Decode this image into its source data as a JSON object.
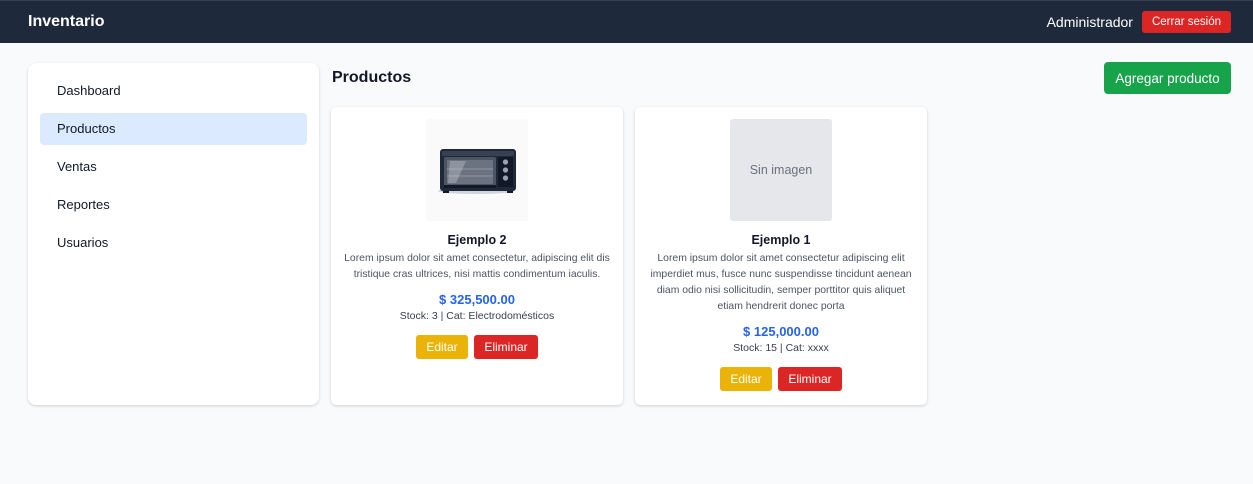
{
  "header": {
    "brand": "Inventario",
    "user": "Administrador",
    "logout_label": "Cerrar sesión"
  },
  "sidebar": {
    "items": [
      {
        "label": "Dashboard",
        "active": false
      },
      {
        "label": "Productos",
        "active": true
      },
      {
        "label": "Ventas",
        "active": false
      },
      {
        "label": "Reportes",
        "active": false
      },
      {
        "label": "Usuarios",
        "active": false
      }
    ]
  },
  "main": {
    "title": "Productos",
    "add_label": "Agregar producto",
    "products": [
      {
        "image": "toaster-oven-photo",
        "name": "Ejemplo 2",
        "description": "Lorem ipsum dolor sit amet consectetur, adipiscing elit dis tristique cras ultrices, nisi mattis condimentum iaculis.",
        "price": "$ 325,500.00",
        "meta": "Stock: 3 | Cat: Electrodomésticos",
        "edit_label": "Editar",
        "delete_label": "Eliminar"
      },
      {
        "image_placeholder": "Sin imagen",
        "name": "Ejemplo 1",
        "description": "Lorem ipsum dolor sit amet consectetur adipiscing elit imperdiet mus, fusce nunc suspendisse tincidunt aenean diam odio nisi sollicitudin, semper porttitor quis aliquet etiam hendrerit donec porta",
        "price": "$ 125,000.00",
        "meta": "Stock: 15 | Cat: xxxx",
        "edit_label": "Editar",
        "delete_label": "Eliminar"
      }
    ]
  },
  "colors": {
    "topbar": "#1e293b",
    "danger": "#dc2626",
    "success": "#16a34a",
    "warning": "#eab308",
    "price": "#2563eb",
    "active_nav": "#dbeafe"
  }
}
